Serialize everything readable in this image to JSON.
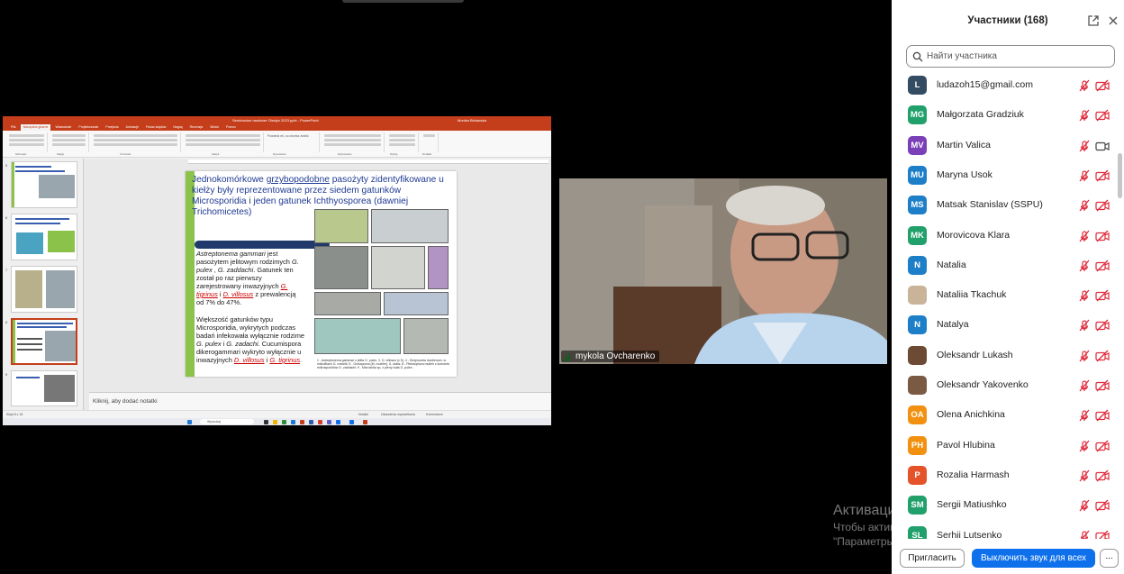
{
  "shared_screen": {
    "powerpoint": {
      "title": "Seminarium naukowe Olsztyn 2023.pptx  -  PowerPoint",
      "user": "Monika Bielawska",
      "tabs": [
        "Plik",
        "Narzędzia główne",
        "Wstawianie",
        "Projektowanie",
        "Przejścia",
        "Animacje",
        "Pokaz slajdów",
        "Nagraj",
        "Recenzja",
        "Widok",
        "Pomoc"
      ],
      "search_hint": "Powiedz mi, co chcesz zrobić",
      "ribbon_groups": [
        "Schowek",
        "Slajdy",
        "Czcionka",
        "Akapit",
        "Rysowanie",
        "Edytowanie",
        "Dyktuj",
        "Dodatki"
      ],
      "thumb_numbers": [
        "5",
        "6",
        "7",
        "8",
        "9"
      ],
      "notes_placeholder": "Kliknij, aby dodać notatki",
      "status_left": "Slajd 8 z 18",
      "status_right": [
        "Notatki",
        "Ustawienia wyświetlania",
        "Komentarze"
      ],
      "taskbar_search": "Wyszukaj"
    },
    "slide": {
      "title_parts": [
        "Jednokomórkowe ",
        "grzybopodobne",
        " pasożyty zidentyfikowane u kiełży były reprezentowane przez siedem gatunków Microsporidia i jeden gatunek Ichthyosporea (dawniej Trichomicetes)"
      ],
      "p1_parts": [
        "Astreptonema gammari",
        " jest pasożytem jelitowym rodzimych ",
        "G. pulex",
        " , ",
        "G. zaddachi",
        ". Gatunek ten został po raz pierwszy zarejestrowany inwazyjnych ",
        "G. tigrinus",
        " i ",
        "D. villosus",
        " z prewalencją od 7% do 47%."
      ],
      "p2_parts": [
        "Większość gatunków typu Microsporidia, wykrytych podczas badań infekowała wyłącznie rodzime ",
        "G. pulex",
        " i ",
        "G. zadachi",
        ". Cucumispora dikerogammari wykryto wyłącznie u inwazyjnych ",
        "D. villosus",
        " i ",
        "G. tigrinus",
        "."
      ],
      "caption": "1 - Astreptonema gammari z jelita G. pulex, 2, D. villosus (x 5), 4 - Dictyocoela duebenum, w mikrofilach G. roeselii; 5 - Octosporea (M. mueller), 6, dukis; 8 - Pleistophora mulleri z komórek mikrosporidiów G. zaddachi; 9 - Microsidia sp. z pleny ciała G. pulex."
    }
  },
  "camera": {
    "participant_name": "mykola Ovcharenko"
  },
  "panel": {
    "title": "Участники (168)",
    "search_placeholder": "Найти участника",
    "participants": [
      {
        "initials": "L",
        "name": "ludazoh15@gmail.com",
        "color": "#334b63",
        "video": "off"
      },
      {
        "initials": "MG",
        "name": "Małgorzata Gradziuk",
        "color": "#22a06b",
        "video": "off"
      },
      {
        "initials": "MV",
        "name": "Martin Valica",
        "color": "#7b3fb8",
        "video": "on"
      },
      {
        "initials": "MU",
        "name": "Maryna Usok",
        "color": "#1e7fc9",
        "video": "off"
      },
      {
        "initials": "MS",
        "name": "Matsak Stanislav (SSPU)",
        "color": "#1e7fc9",
        "video": "off"
      },
      {
        "initials": "MK",
        "name": "Morovicova Klara",
        "color": "#22a06b",
        "video": "off"
      },
      {
        "initials": "N",
        "name": "Natalia",
        "color": "#1e7fc9",
        "video": "off"
      },
      {
        "initials": "",
        "name": "Nataliia Tkachuk",
        "color": "#c9b49a",
        "video": "off"
      },
      {
        "initials": "N",
        "name": "Natalya",
        "color": "#1e7fc9",
        "video": "off"
      },
      {
        "initials": "",
        "name": "Oleksandr Lukash",
        "color": "#6d4a34",
        "video": "off"
      },
      {
        "initials": "",
        "name": "Oleksandr Yakovenko",
        "color": "#7a5a43",
        "video": "off"
      },
      {
        "initials": "OA",
        "name": "Olena Anichkina",
        "color": "#f29111",
        "video": "off"
      },
      {
        "initials": "PH",
        "name": "Pavol Hlubina",
        "color": "#f29111",
        "video": "off"
      },
      {
        "initials": "P",
        "name": "Rozalia Harmash",
        "color": "#e5532a",
        "video": "off"
      },
      {
        "initials": "SM",
        "name": "Sergii Matiushko",
        "color": "#22a06b",
        "video": "off"
      },
      {
        "initials": "SL",
        "name": "Serhii Lutsenko",
        "color": "#22a06b",
        "video": "off"
      }
    ],
    "mic_icon": "mic-muted-icon",
    "video_icon": "video-off-icon",
    "footer": {
      "invite": "Пригласить",
      "mute_all": "Выключить звук для всех",
      "more": "..."
    }
  },
  "watermark": {
    "line1": "Активация Windows",
    "line2": "Чтобы активировать Windows, перейдите в раздел",
    "line3": "\"Параметры\"."
  }
}
